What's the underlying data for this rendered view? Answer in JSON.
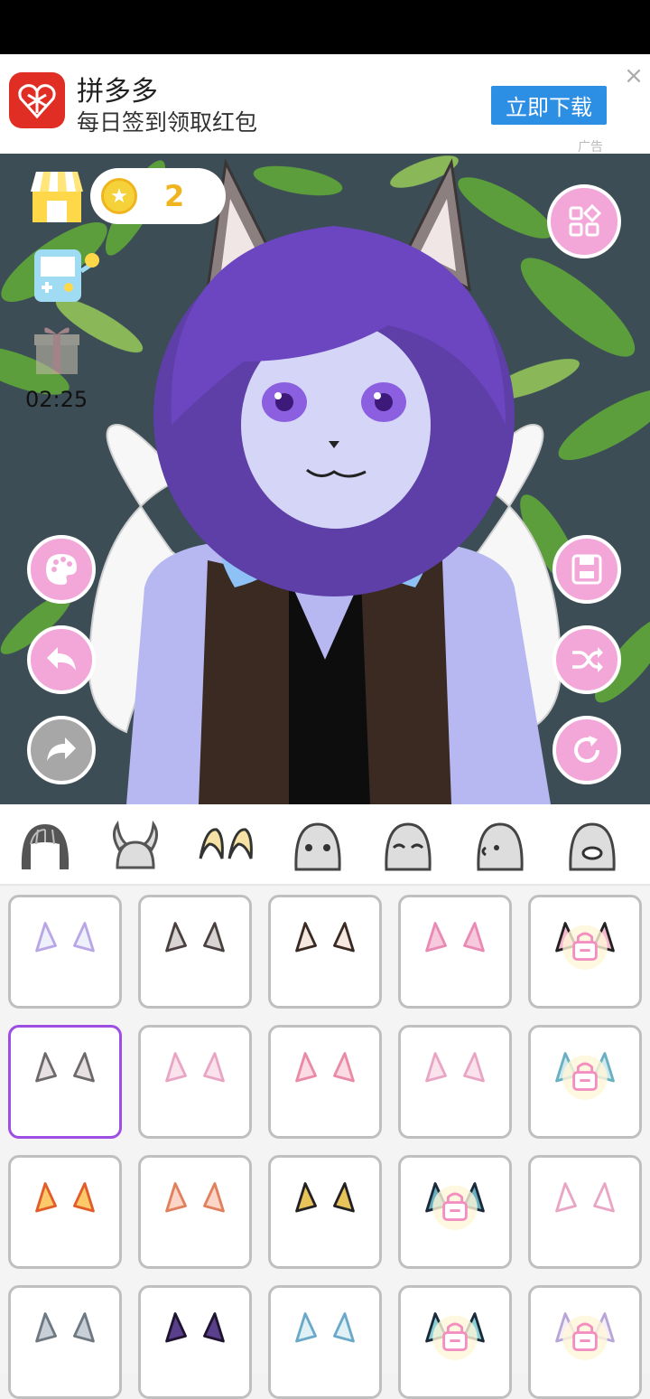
{
  "ad": {
    "app_name": "拼多多",
    "slogan": "每日签到领取红包",
    "download_label": "立即下载",
    "close_glyph": "×",
    "ad_tag": "广告",
    "logo_color": "#e02e24",
    "button_color": "#2d8fe4"
  },
  "hud": {
    "coin_count": "2",
    "timer": "02:25",
    "accent": "#f3a7d8"
  },
  "side_buttons": {
    "left": [
      "palette-icon",
      "undo-icon",
      "redo-icon"
    ],
    "right": [
      "grid-menu-icon",
      "save-icon",
      "shuffle-icon",
      "reset-icon"
    ]
  },
  "category_tabs": [
    "hair-icon",
    "horns-icon",
    "ears-icon",
    "face-icon",
    "eyes-face-icon",
    "side-face-icon",
    "mouth-face-icon"
  ],
  "selected_tab": "ears-icon",
  "ear_grid": {
    "selected_index": 5,
    "items": [
      {
        "style": "white-small",
        "locked": false
      },
      {
        "style": "gray-cat",
        "locked": false
      },
      {
        "style": "brown-cat",
        "locked": false
      },
      {
        "style": "pink-long",
        "locked": false
      },
      {
        "style": "black-pink",
        "locked": true
      },
      {
        "style": "fluffy-gray",
        "locked": false
      },
      {
        "style": "white-bunny",
        "locked": false
      },
      {
        "style": "feather-pink",
        "locked": false
      },
      {
        "style": "side-wing",
        "locked": false
      },
      {
        "style": "crystal",
        "locked": true
      },
      {
        "style": "orange-fox",
        "locked": false
      },
      {
        "style": "peach-cat",
        "locked": false
      },
      {
        "style": "gold-horn",
        "locked": false
      },
      {
        "style": "dark-feather",
        "locked": true
      },
      {
        "style": "tiny-white",
        "locked": false
      },
      {
        "style": "tiny-gray",
        "locked": false
      },
      {
        "style": "purple-dark",
        "locked": false
      },
      {
        "style": "elf-blue",
        "locked": false
      },
      {
        "style": "teal-dark",
        "locked": true
      },
      {
        "style": "white-fluffy",
        "locked": true
      }
    ]
  }
}
